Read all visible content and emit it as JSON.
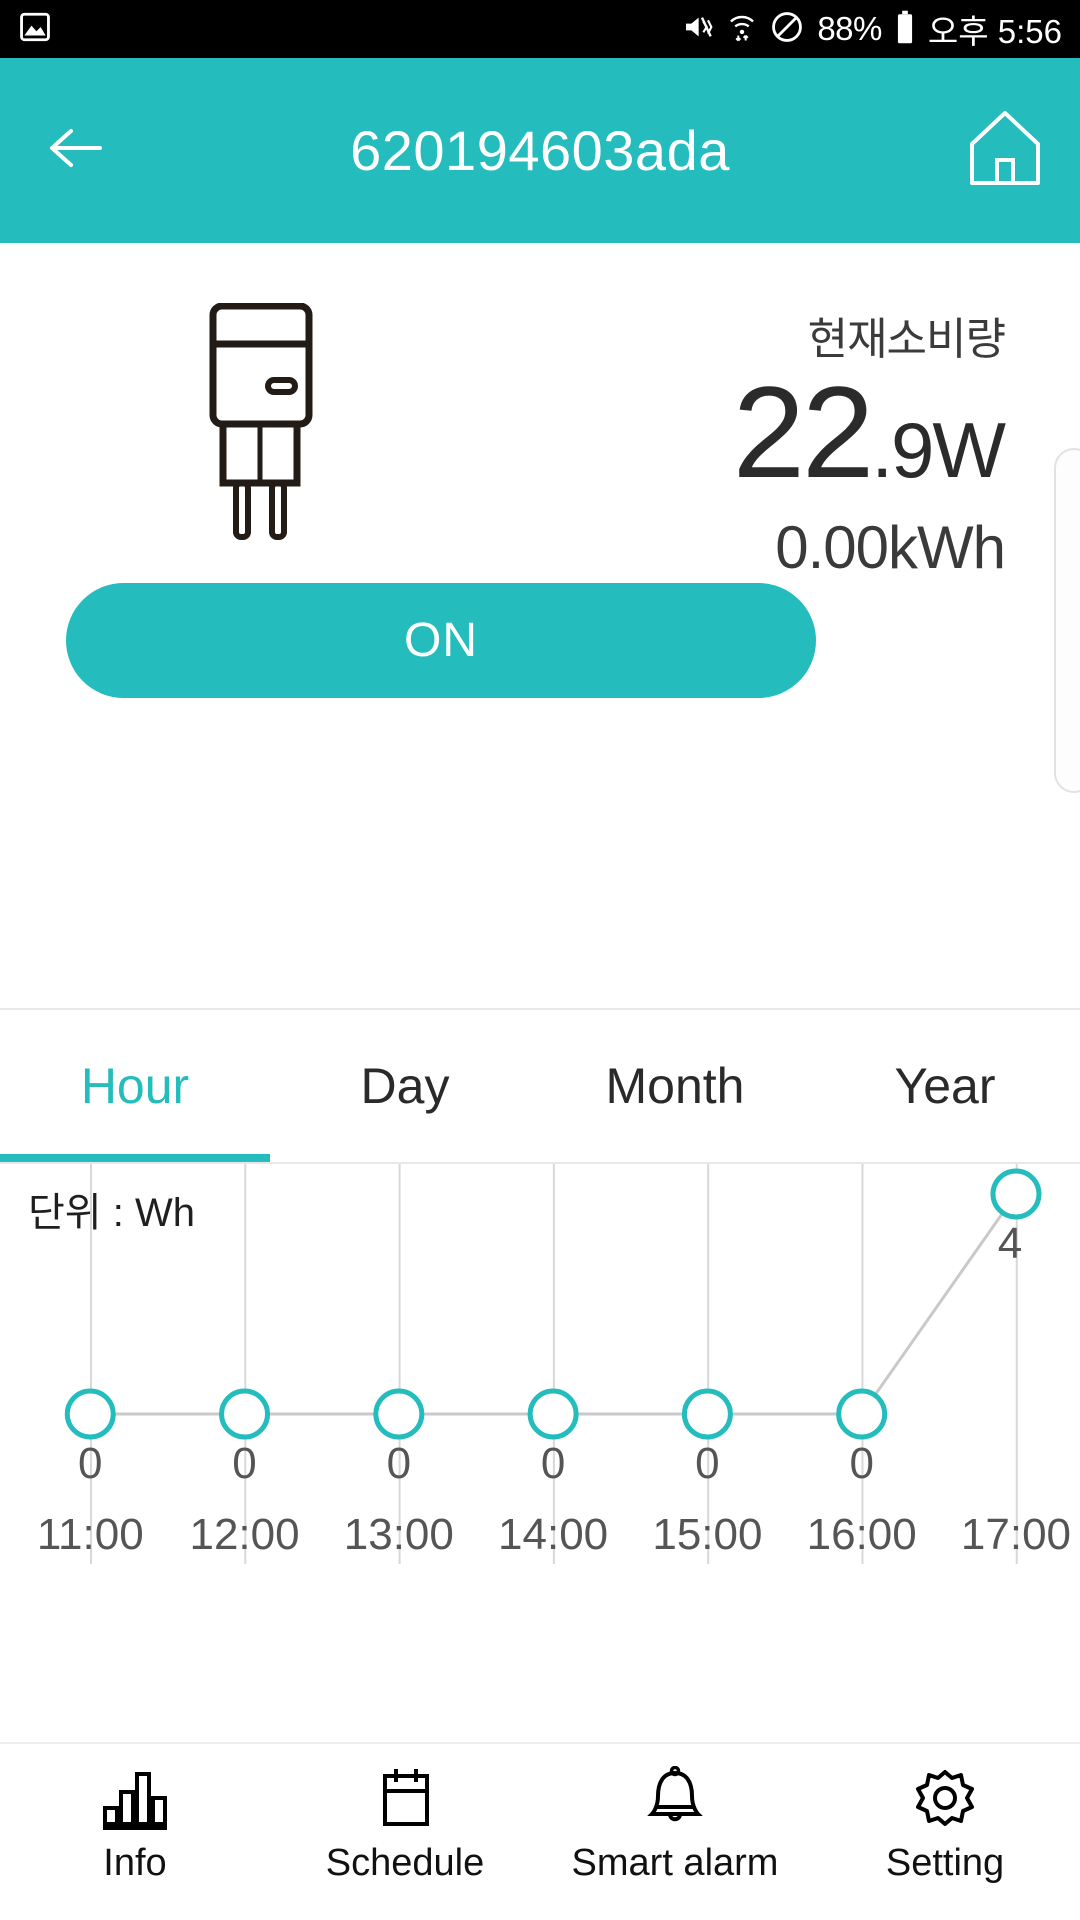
{
  "statusbar": {
    "left_icon": "image-icon",
    "icons": [
      "vibrate-mute-icon",
      "wifi-icon",
      "do-not-disturb-icon"
    ],
    "battery_percent": "88%",
    "battery_icon": "battery-icon",
    "time": "오후 5:56"
  },
  "header": {
    "back_icon": "back-arrow-icon",
    "title": "620194603ada",
    "home_icon": "home-icon",
    "background": "#24bcbc"
  },
  "device": {
    "plug_icon": "power-plug-icon",
    "status_label": "ON",
    "consumption_label": "현재소비량",
    "power_integer": "22",
    "power_decimal": ".9",
    "power_unit": "W",
    "energy": "0.00kWh",
    "toggle_label": "ON",
    "toggle_color": "#24bcbc"
  },
  "tabs": {
    "items": [
      {
        "label": "Hour",
        "active": true
      },
      {
        "label": "Day",
        "active": false
      },
      {
        "label": "Month",
        "active": false
      },
      {
        "label": "Year",
        "active": false
      }
    ],
    "active_color": "#24bcbc"
  },
  "chart_data": {
    "type": "line",
    "title": "",
    "unit_label": "단위 : Wh",
    "xlabel": "",
    "ylabel": "Wh",
    "categories": [
      "11:00",
      "12:00",
      "13:00",
      "14:00",
      "15:00",
      "16:00",
      "17:00"
    ],
    "values": [
      0,
      0,
      0,
      0,
      0,
      0,
      4
    ],
    "point_labels": [
      "0",
      "0",
      "0",
      "0",
      "0",
      "0",
      "4"
    ],
    "ylim": [
      0,
      4
    ],
    "grid": true,
    "legend": "none",
    "marker_color": "#24bcbc",
    "line_color": "#c9c9c9",
    "label_color": "#555555"
  },
  "bottomnav": {
    "items": [
      {
        "label": "Info",
        "icon": "bar-chart-icon"
      },
      {
        "label": "Schedule",
        "icon": "calendar-icon"
      },
      {
        "label": "Smart alarm",
        "icon": "bell-icon"
      },
      {
        "label": "Setting",
        "icon": "gear-icon"
      }
    ]
  }
}
